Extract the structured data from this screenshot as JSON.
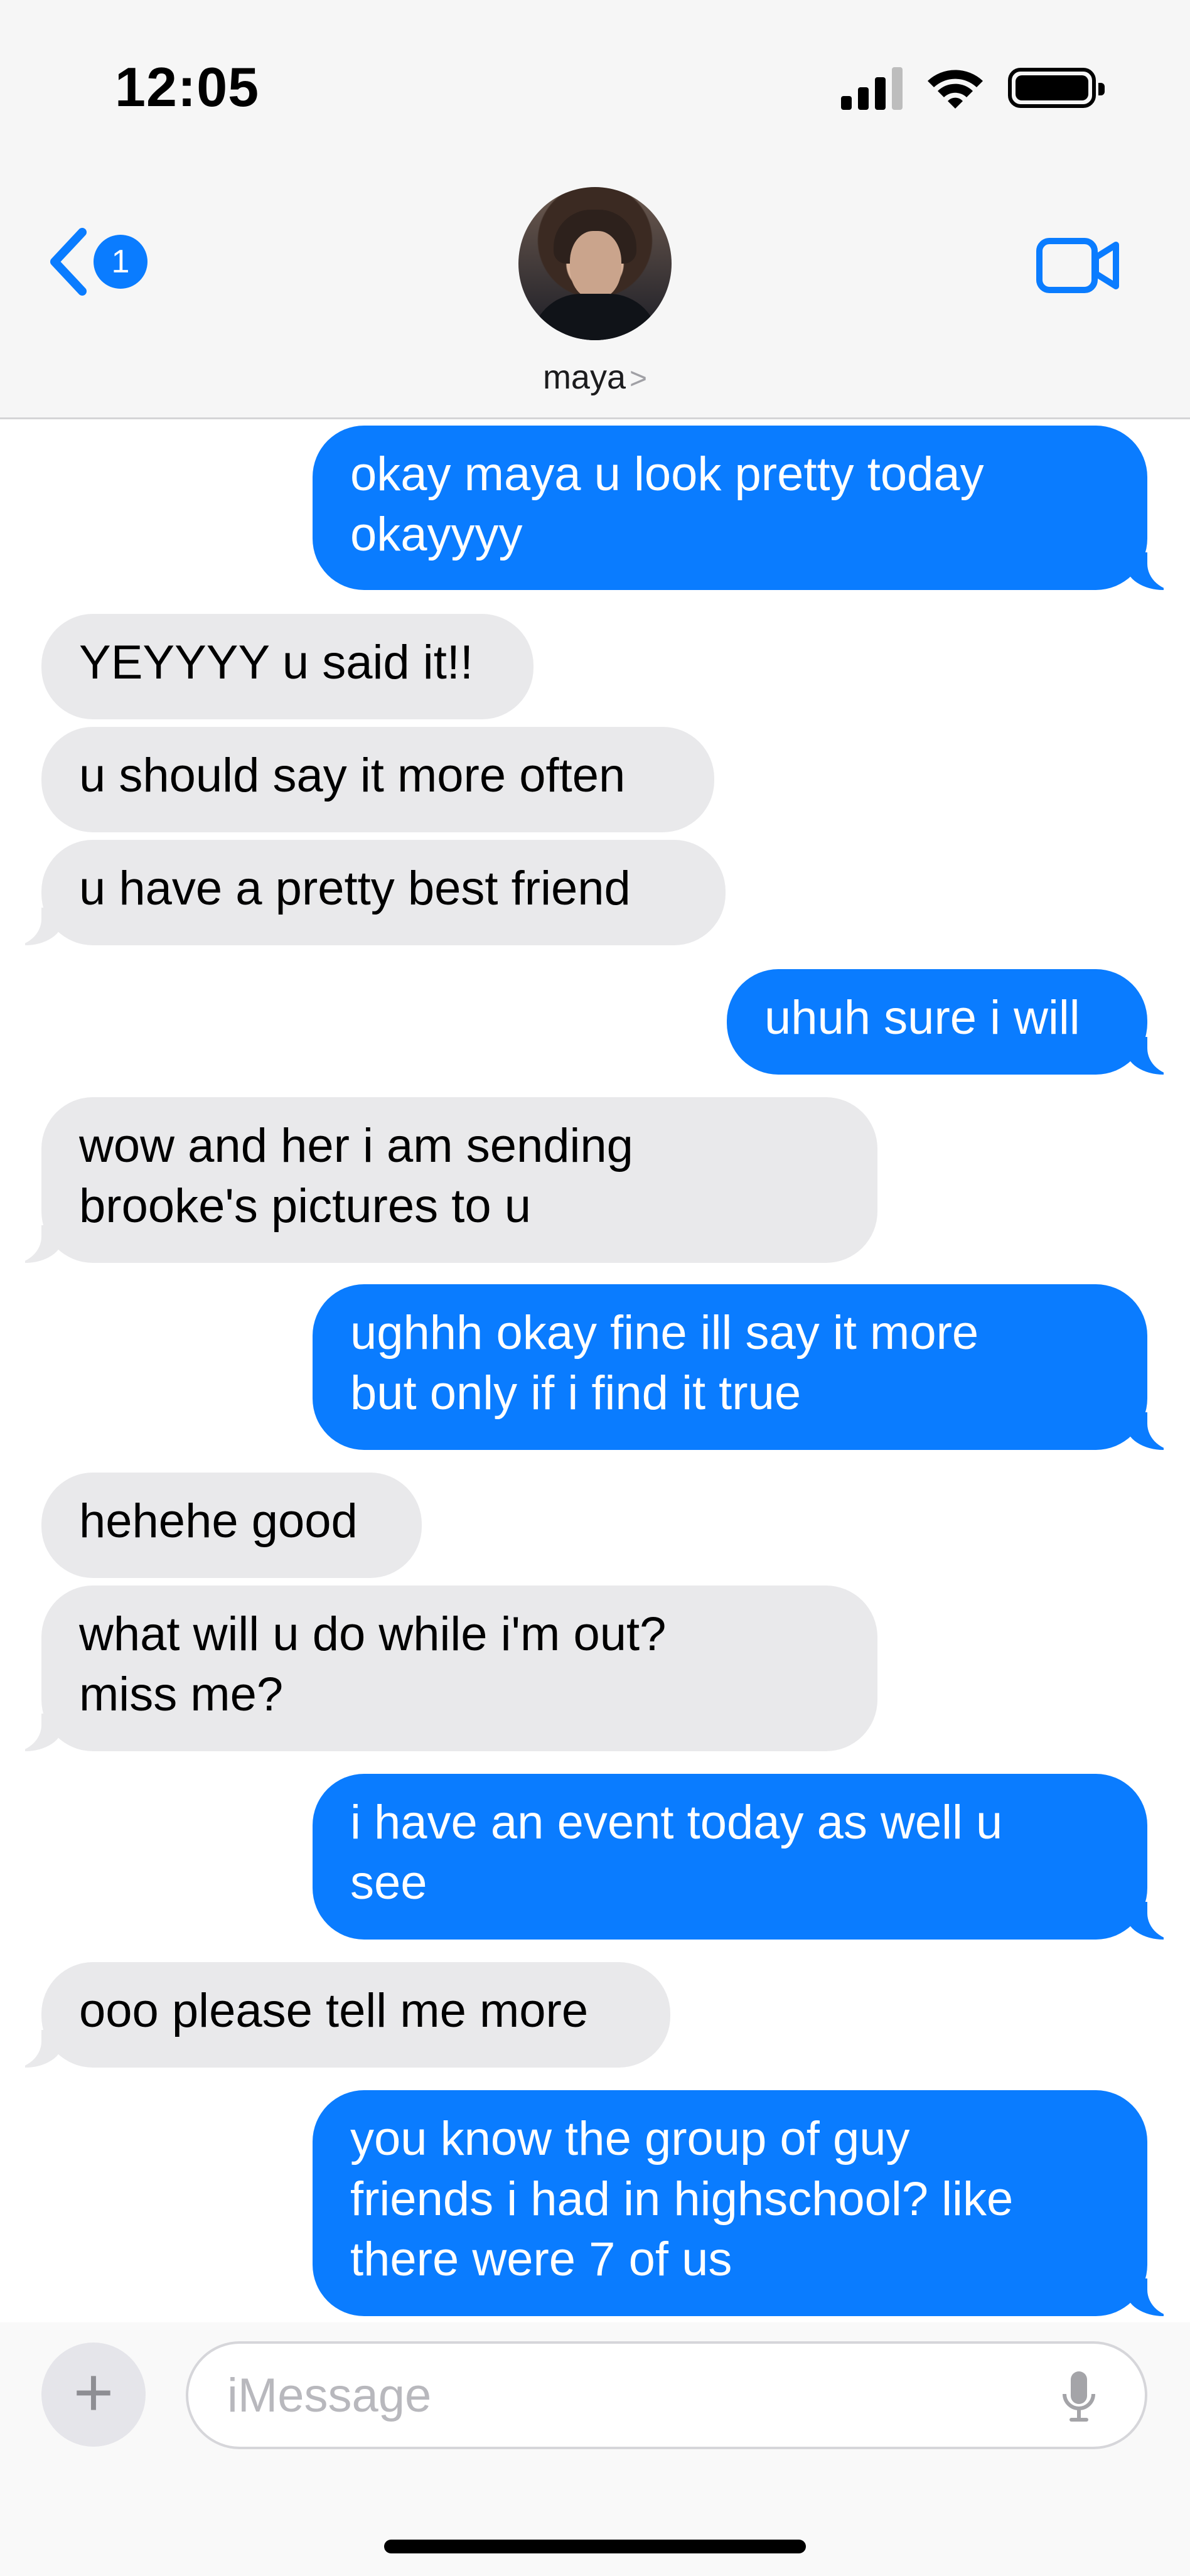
{
  "status_bar": {
    "time": "12:05"
  },
  "header": {
    "back_badge": "1",
    "contact_name": "maya",
    "chevron": ">"
  },
  "colors": {
    "outgoing": "#0a7cff",
    "incoming": "#e9e9eb",
    "accent": "#0a7cff"
  },
  "messages": [
    {
      "dir": "out",
      "text": "okay maya u look pretty today\nokayyyy"
    },
    {
      "dir": "in",
      "text": "YEYYYY u said it!!"
    },
    {
      "dir": "in",
      "text": "u should say it more often"
    },
    {
      "dir": "in",
      "text": "u have a pretty best friend"
    },
    {
      "dir": "out",
      "text": "uhuh sure i will"
    },
    {
      "dir": "in",
      "text": "wow and her i am sending\nbrooke's pictures to u"
    },
    {
      "dir": "out",
      "text": "ughhh okay fine ill say it more\nbut only if i find it true"
    },
    {
      "dir": "in",
      "text": "hehehe good"
    },
    {
      "dir": "in",
      "text": "what will u do while i'm out?\nmiss me?"
    },
    {
      "dir": "out",
      "text": "i have an event today as well u\nsee"
    },
    {
      "dir": "in",
      "text": "ooo please tell me more"
    },
    {
      "dir": "out",
      "text": "you know the group of guy\nfriends i had in highschool? like\nthere were 7 of us"
    }
  ],
  "composer": {
    "placeholder": "iMessage",
    "plus": "+"
  },
  "icons": [
    "back-chevron-icon",
    "video-camera-icon",
    "signal-icon",
    "wifi-icon",
    "battery-icon",
    "microphone-icon",
    "plus-icon"
  ]
}
